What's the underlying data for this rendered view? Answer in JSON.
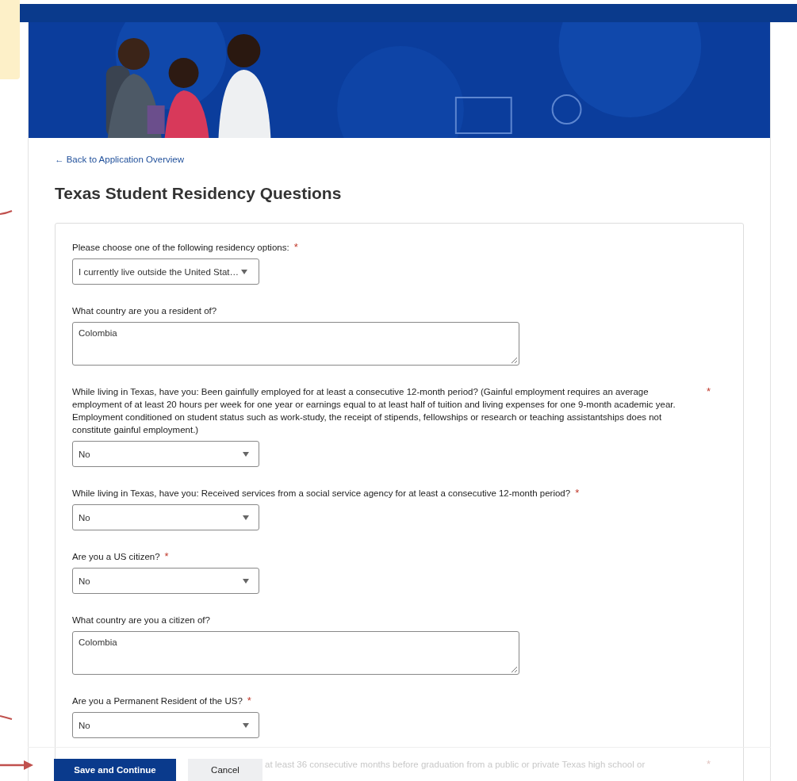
{
  "back_link": "← Back to Application Overview",
  "heading": "Texas Student Residency Questions",
  "questions": [
    {
      "kind": "select",
      "label": "Please choose one of the following residency options:",
      "required_mark": "*",
      "value": "I currently live outside the United Stat…"
    },
    {
      "kind": "textarea",
      "label": "What country are you a resident of?",
      "value": "Colombia"
    },
    {
      "kind": "select",
      "label": "While living in Texas, have you: Been gainfully employed for at least a consecutive 12-month period? (Gainful employment requires an average employment of at least 20 hours per week for one year or earnings equal to at least half of tuition and living expenses for one 9-month academic year. Employment conditioned on student status such as work-study, the receipt of stipends, fellowships or research or teaching assistantships does not constitute gainful employment.)",
      "required_mark": "*",
      "value": "No"
    },
    {
      "kind": "select",
      "label": "While living in Texas, have you: Received services from a social service agency for at least a consecutive 12-month period?",
      "required_mark": "*",
      "value": "No"
    },
    {
      "kind": "select",
      "label": "Are you a US citizen?",
      "required_mark": "*",
      "value": "No"
    },
    {
      "kind": "textarea",
      "label": "What country are you a citizen of?",
      "value": "Colombia"
    },
    {
      "kind": "select",
      "label": "Are you a Permanent Resident of the US?",
      "required_mark": "*",
      "value": "No"
    }
  ],
  "partial_question": {
    "text": "at least 36 consecutive months before graduation from a public or private Texas high school or",
    "required_mark": "*"
  },
  "buttons": [
    {
      "label": "Save and Continue",
      "kind": "primary"
    },
    {
      "label": "Cancel",
      "kind": "secondary"
    }
  ]
}
